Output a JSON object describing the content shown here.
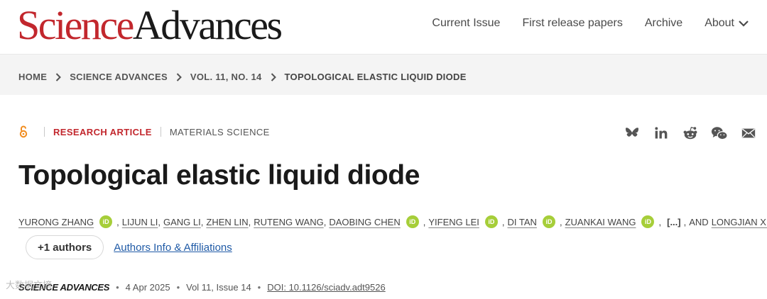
{
  "header": {
    "logo_science": "Science",
    "logo_advances": "Advances",
    "nav": [
      {
        "label": "Current Issue"
      },
      {
        "label": "First release papers"
      },
      {
        "label": "Archive"
      },
      {
        "label": "About"
      }
    ]
  },
  "breadcrumb": [
    "HOME",
    "SCIENCE ADVANCES",
    "VOL. 11, NO. 14",
    "TOPOLOGICAL ELASTIC LIQUID DIODE"
  ],
  "article": {
    "type": "RESEARCH ARTICLE",
    "subject": "MATERIALS SCIENCE",
    "title": "Topological elastic liquid diode",
    "authors": [
      "YURONG ZHANG",
      "LIJUN LI",
      "GANG LI",
      "ZHEN LIN",
      "RUTENG WANG",
      "DAOBING CHEN",
      "YIFENG LEI",
      "DI TAN",
      "ZUANKAI WANG",
      "LONGJIAN XUE"
    ],
    "ellipsis": "[...]",
    "and": "AND",
    "orcid_label": "iD",
    "more_authors": "+1 authors",
    "affiliations_link": "Authors Info & Affiliations",
    "journal": "SCIENCE ADVANCES",
    "date": "4 Apr 2025",
    "volume": "Vol 11, Issue 14",
    "doi": "DOI: 10.1126/sciadv.adt9526"
  },
  "share_icons": [
    "bluesky-icon",
    "linkedin-icon",
    "reddit-icon",
    "wechat-icon",
    "email-icon"
  ],
  "watermark": "大数据文摘",
  "colors": {
    "brand_red": "#c2272d",
    "orcid_green": "#a6ce39",
    "link_blue": "#1f5aa6"
  }
}
